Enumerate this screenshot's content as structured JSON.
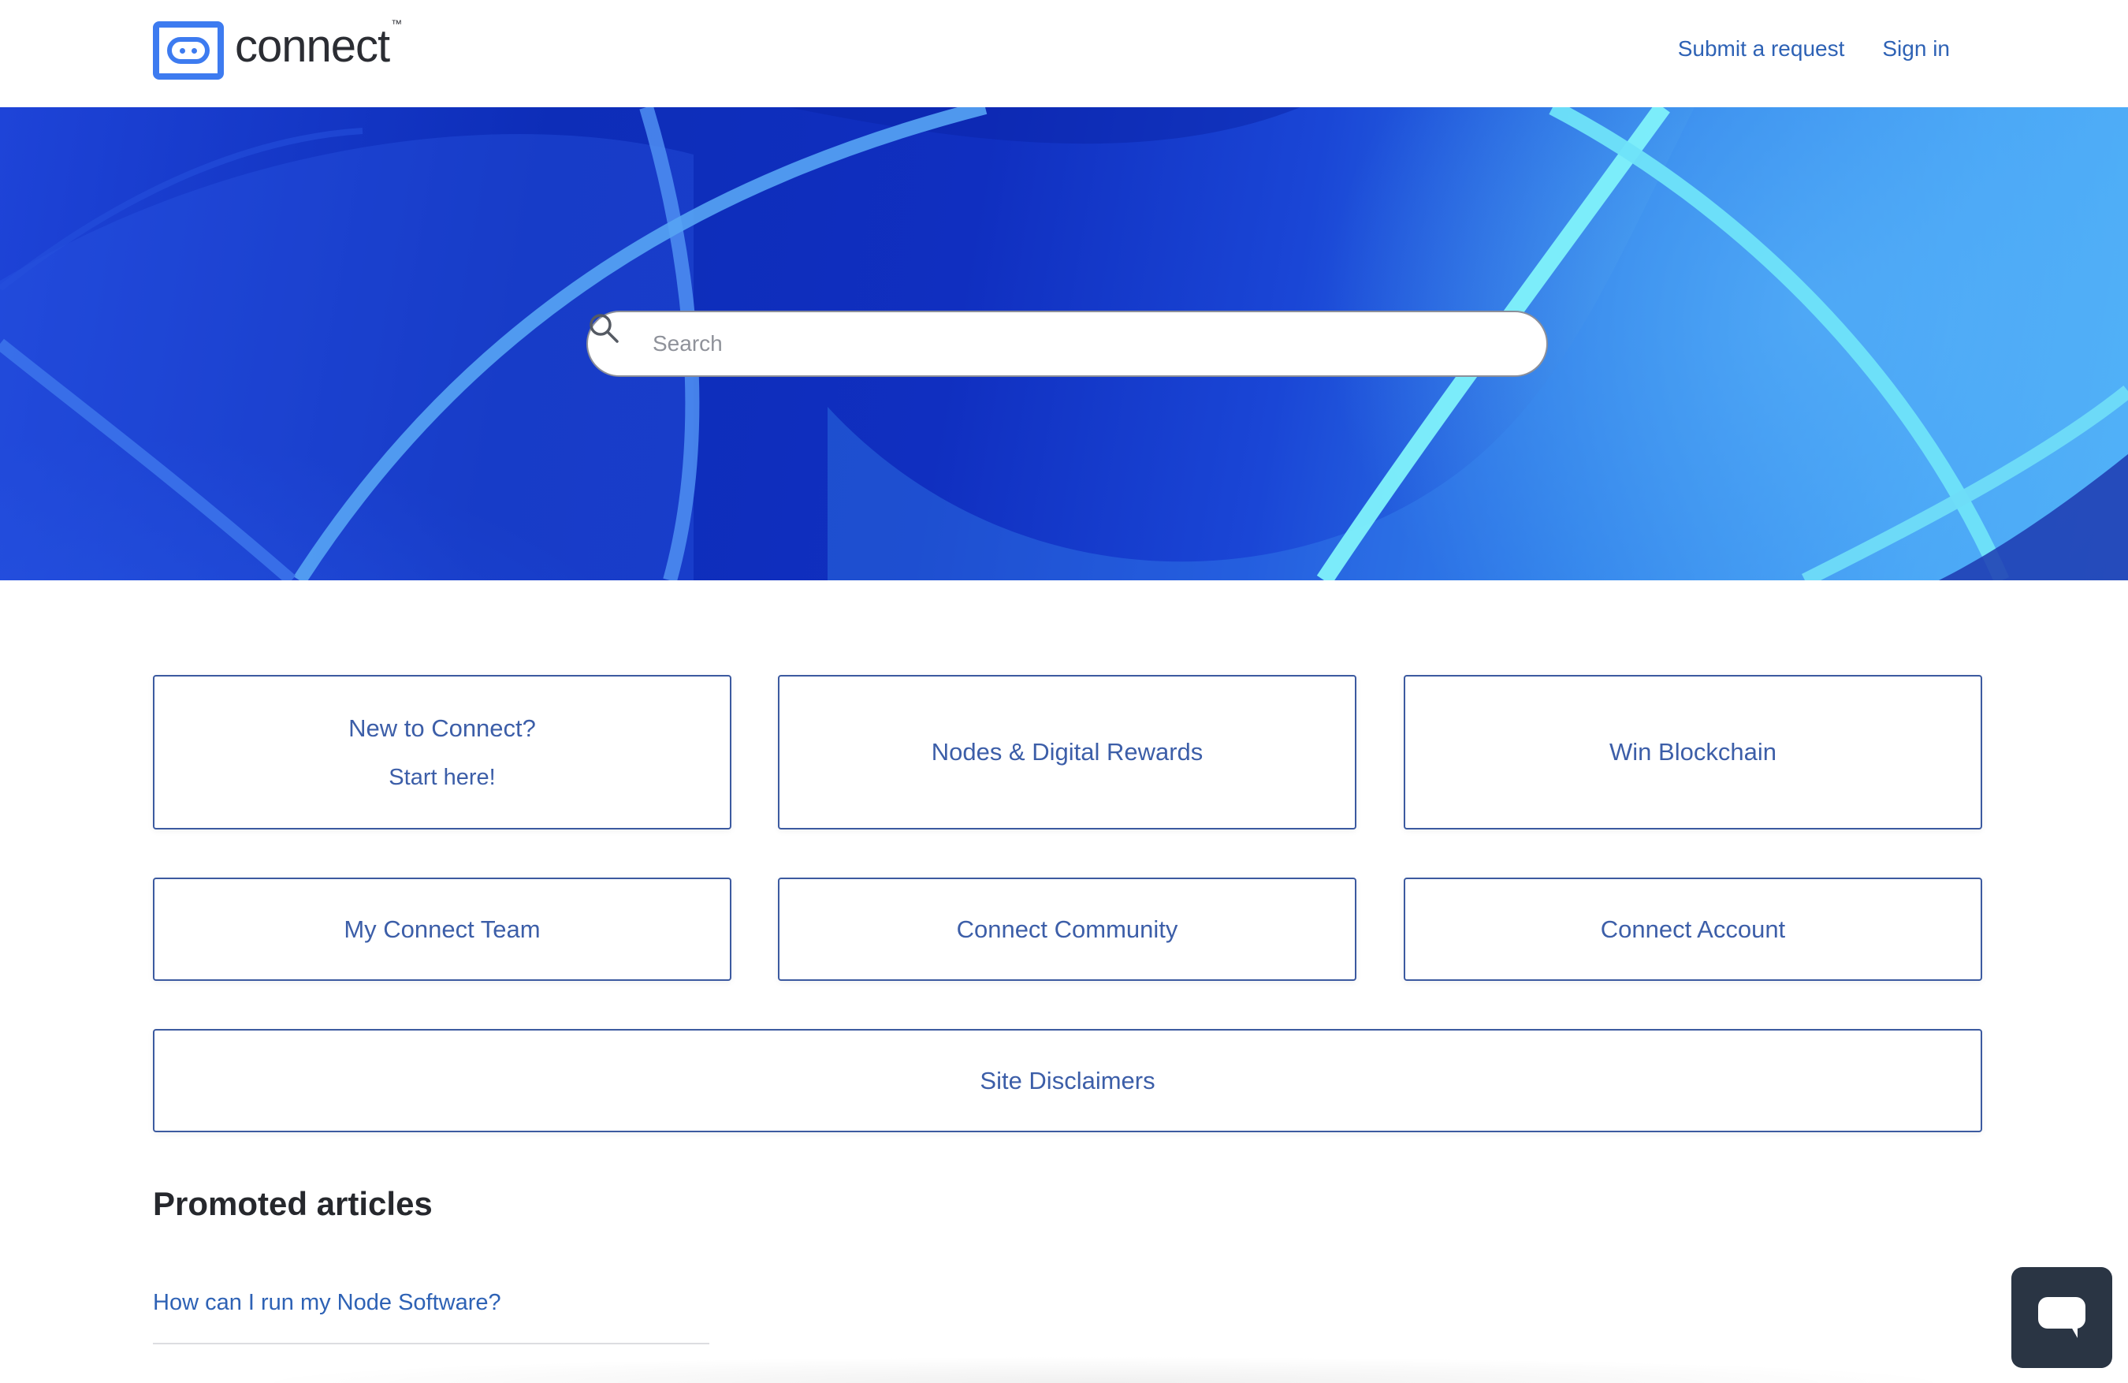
{
  "brand": {
    "name": "connect",
    "trademark": "™",
    "color": "#3d7bf0"
  },
  "header": {
    "nav": [
      {
        "label": "Submit a request"
      },
      {
        "label": "Sign in"
      }
    ]
  },
  "hero": {
    "search": {
      "placeholder": "Search",
      "value": ""
    }
  },
  "categories": [
    {
      "line1": "New to Connect?",
      "line2": "Start here!"
    },
    {
      "line1": "Nodes & Digital Rewards"
    },
    {
      "line1": "Win Blockchain"
    },
    {
      "line1": "My Connect Team"
    },
    {
      "line1": "Connect Community"
    },
    {
      "line1": "Connect Account"
    },
    {
      "line1": "Site Disclaimers"
    }
  ],
  "promoted": {
    "title": "Promoted articles",
    "articles": [
      {
        "title": "How can I run my Node Software?"
      }
    ]
  },
  "chat": {
    "icon": "chat-bubble-icon"
  },
  "colors": {
    "link": "#2e62b5",
    "card_border": "#3c5aa0",
    "hero_dark": "#0d2db8",
    "hero_light": "#5bc4fb",
    "chat_bg": "#2a3544"
  }
}
